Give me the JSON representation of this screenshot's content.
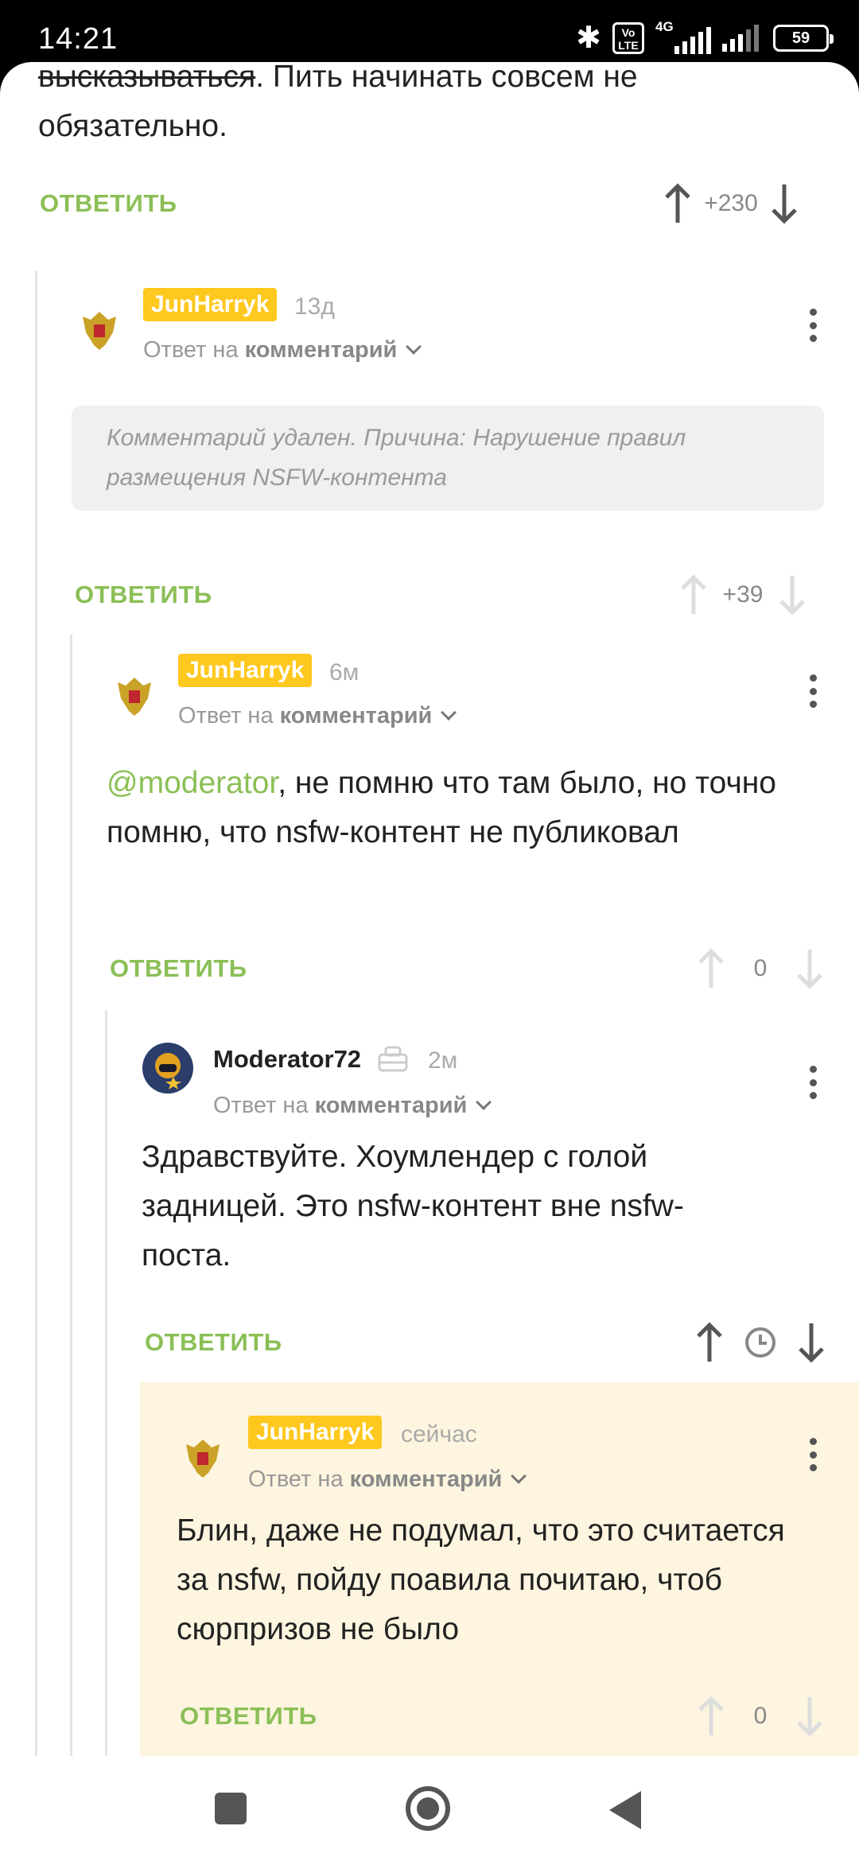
{
  "status_bar": {
    "time": "14:21",
    "volte": "Vo LTE",
    "network": "4G",
    "battery": "59"
  },
  "top_comment": {
    "strike_text": "высказываться",
    "text": ". Пить начинать совсем не обязательно.",
    "reply_label": "ОТВЕТИТЬ",
    "score": "+230"
  },
  "comments": [
    {
      "user": "JunHarryk",
      "time": "13д",
      "reply_to_prefix": "Ответ на",
      "reply_to_link": "комментарий",
      "deleted_text": "Комментарий удален. Причина: Нарушение правил размещения NSFW-контента",
      "reply_label": "ОТВЕТИТЬ",
      "score": "+39"
    },
    {
      "user": "JunHarryk",
      "time": "6м",
      "reply_to_prefix": "Ответ на",
      "reply_to_link": "комментарий",
      "mention": "@moderator",
      "text": ", не помню что там было, но точно помню, что nsfw-контент не публиковал",
      "reply_label": "ОТВЕТИТЬ",
      "score": "0"
    },
    {
      "user": "Moderator72",
      "time": "2м",
      "reply_to_prefix": "Ответ на",
      "reply_to_link": "комментарий",
      "text": "Здравствуйте. Хоумлендер с голой задницей. Это nsfw-контент вне nsfw-поста.",
      "reply_label": "ОТВЕТИТЬ"
    },
    {
      "user": "JunHarryk",
      "time": "сейчас",
      "reply_to_prefix": "Ответ на",
      "reply_to_link": "комментарий",
      "text": "Блин, даже не подумал, что это считается за nsfw, пойду поавила почитаю, чтоб сюрпризов не было",
      "reply_label": "ОТВЕТИТЬ",
      "score": "0"
    }
  ],
  "colors": {
    "accent_green": "#8bbf56",
    "user_badge": "#ffc81e",
    "highlight_bg": "#fdf5df"
  },
  "icons": [
    "bluetooth-icon",
    "signal-icon",
    "battery-icon",
    "upvote-icon",
    "downvote-icon",
    "clock-icon",
    "more-icon",
    "moderator-icon"
  ]
}
